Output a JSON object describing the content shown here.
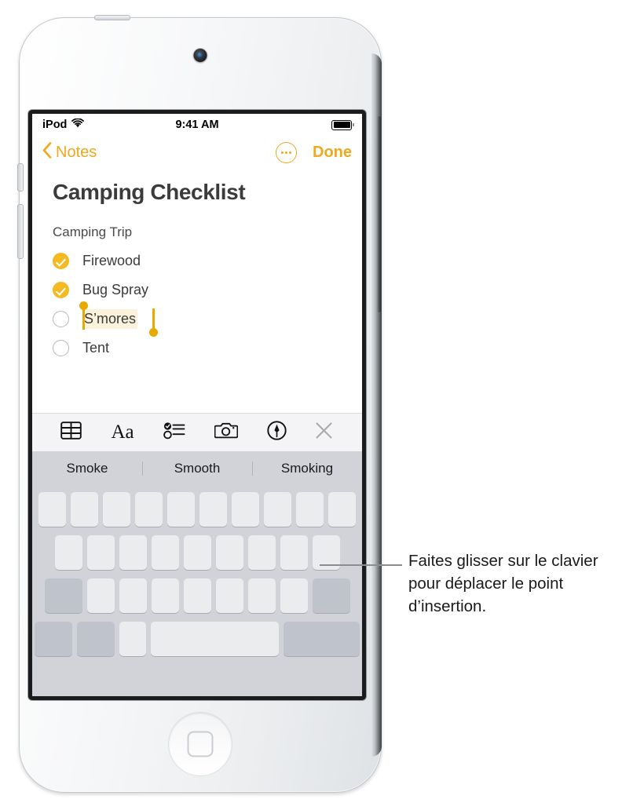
{
  "device": {
    "name": "ipod-touch",
    "camera": "front-camera",
    "home_button": "home-button"
  },
  "status_bar": {
    "carrier": "iPod",
    "wifi_icon": "wifi-icon",
    "time": "9:41 AM",
    "battery_icon": "battery-full-icon"
  },
  "nav_bar": {
    "back_label": "Notes",
    "back_icon": "chevron-left-icon",
    "more_icon": "ellipsis-circle-icon",
    "done_label": "Done"
  },
  "note": {
    "title": "Camping Checklist",
    "subtitle": "Camping Trip",
    "items": [
      {
        "label": "Firewood",
        "checked": true,
        "selected": false
      },
      {
        "label": "Bug Spray",
        "checked": true,
        "selected": false
      },
      {
        "label": "S’mores",
        "checked": false,
        "selected": true
      },
      {
        "label": "Tent",
        "checked": false,
        "selected": false
      }
    ]
  },
  "format_toolbar": {
    "items": [
      {
        "icon": "table-icon",
        "name": "insert-table-button"
      },
      {
        "icon": "text-format-icon",
        "name": "text-format-button",
        "label": "Aa"
      },
      {
        "icon": "checklist-icon",
        "name": "checklist-button"
      },
      {
        "icon": "camera-icon",
        "name": "camera-button"
      },
      {
        "icon": "markup-pen-icon",
        "name": "markup-button"
      },
      {
        "icon": "close-icon",
        "name": "close-toolbar-button"
      }
    ]
  },
  "suggestions": {
    "items": [
      "Smoke",
      "Smooth",
      "Smoking"
    ]
  },
  "keyboard": {
    "rows": [
      {
        "keys": 10,
        "type": "letters"
      },
      {
        "keys": 9,
        "type": "letters"
      },
      {
        "keys": 9,
        "type": "letters-with-shift-delete"
      },
      {
        "keys": 5,
        "type": "bottom-row"
      }
    ]
  },
  "callout": {
    "text": "Faites glisser sur le clavier pour déplacer le point d’insertion."
  },
  "colors": {
    "accent": "#F0A81C",
    "checkbox": "#F5B921",
    "selection_handle": "#E8A900",
    "selection_highlight": "#FBF2DC",
    "keyboard_bg": "#D1D3D9",
    "key_light": "#EBECEE",
    "key_dark": "#BFC3CB",
    "toolbar_bg": "#F4F4F6"
  }
}
